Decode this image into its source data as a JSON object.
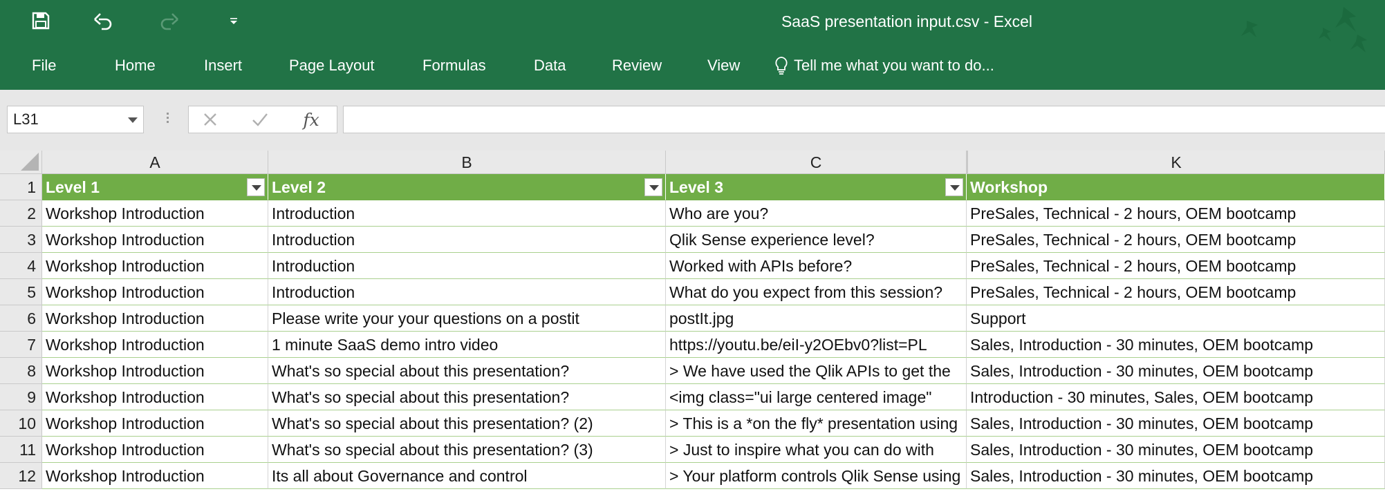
{
  "window": {
    "title": "SaaS presentation input.csv - Excel"
  },
  "qat": [
    "save-icon",
    "undo-icon",
    "redo-icon",
    "customize-qat-icon"
  ],
  "ribbon_tabs": [
    "File",
    "Home",
    "Insert",
    "Page Layout",
    "Formulas",
    "Data",
    "Review",
    "View"
  ],
  "tell_me": {
    "icon": "lightbulb-icon",
    "text": "Tell me what you want to do..."
  },
  "formula_bar": {
    "name_box": "L31",
    "cancel_icon": "cancel-icon",
    "enter_icon": "enter-icon",
    "fx": "fx",
    "formula": ""
  },
  "sheet": {
    "columns": [
      "A",
      "B",
      "C",
      "K"
    ],
    "row_numbers": [
      "1",
      "2",
      "3",
      "4",
      "5",
      "6",
      "7",
      "8",
      "9",
      "10",
      "11",
      "12"
    ],
    "headers": [
      "Level 1",
      "Level 2",
      "Level 3",
      "Workshop"
    ],
    "rows": [
      [
        "Workshop Introduction",
        "Introduction",
        "Who are you?",
        "PreSales, Technical - 2 hours, OEM bootcamp"
      ],
      [
        "Workshop Introduction",
        "Introduction",
        "Qlik Sense experience level?",
        "PreSales, Technical - 2 hours, OEM bootcamp"
      ],
      [
        "Workshop Introduction",
        "Introduction",
        "Worked with APIs before?",
        "PreSales, Technical - 2 hours, OEM bootcamp"
      ],
      [
        "Workshop Introduction",
        "Introduction",
        "What do you expect from this session?",
        "PreSales, Technical - 2 hours, OEM bootcamp"
      ],
      [
        "Workshop Introduction",
        "Please write your your questions on a postit",
        "postIt.jpg",
        "Support"
      ],
      [
        "Workshop Introduction",
        "1 minute SaaS demo intro video",
        "https://youtu.be/eiI-y2OEbv0?list=PL",
        "Sales, Introduction - 30 minutes, OEM bootcamp"
      ],
      [
        "Workshop Introduction",
        "What's so special about this presentation?",
        "> We have used the Qlik APIs to get the",
        "Sales, Introduction - 30 minutes, OEM bootcamp"
      ],
      [
        "Workshop Introduction",
        "What's so special about this presentation?",
        " <img class=\"ui large centered image\"",
        "Introduction - 30 minutes, Sales, OEM bootcamp"
      ],
      [
        "Workshop Introduction",
        "What's so special about this presentation? (2)",
        "> This is a *on the fly* presentation using",
        "Sales, Introduction - 30 minutes, OEM bootcamp"
      ],
      [
        "Workshop Introduction",
        "What's so special about this presentation? (3)",
        "> Just to inspire what you can do with",
        "Sales, Introduction - 30 minutes, OEM bootcamp"
      ],
      [
        "Workshop Introduction",
        "Its all about Governance and control",
        "> Your platform controls Qlik Sense using",
        "Sales, Introduction - 30 minutes, OEM bootcamp"
      ]
    ]
  },
  "colors": {
    "ribbon": "#217346",
    "table_header": "#70ad47",
    "table_border": "#a9d08e",
    "grid_header": "#e9e9e9"
  }
}
